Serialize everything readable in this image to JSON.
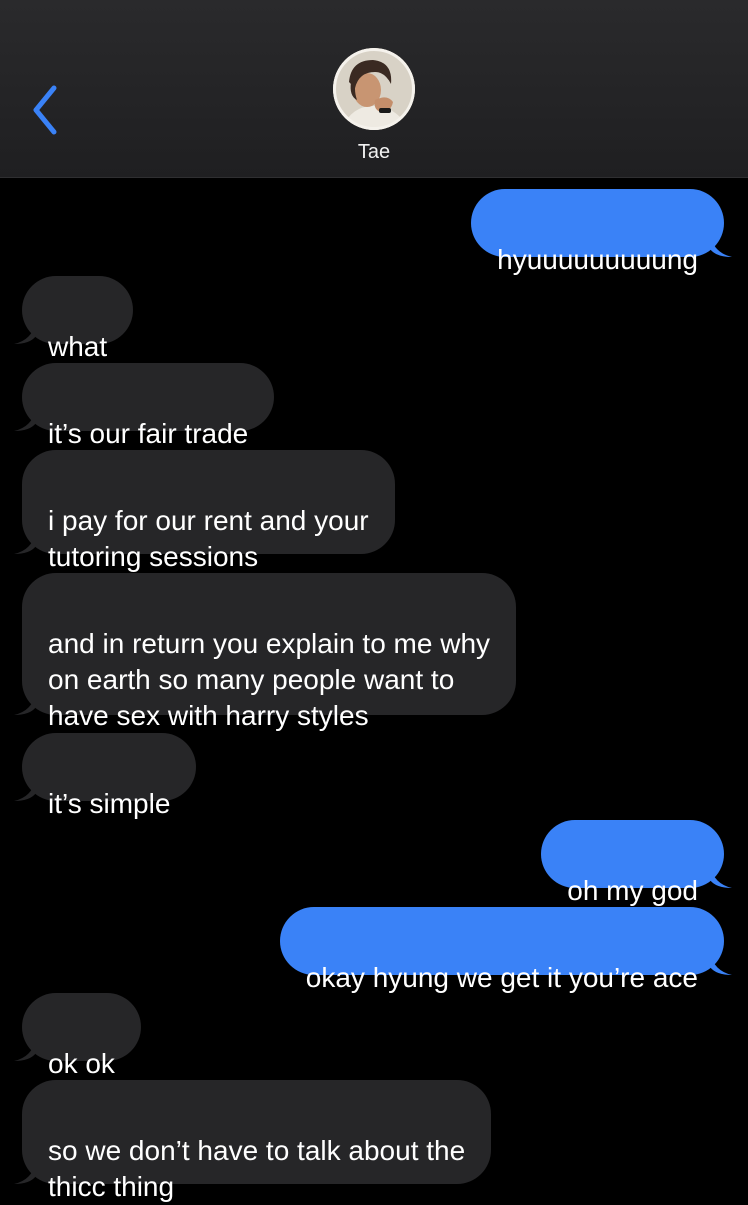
{
  "header": {
    "contact_name": "Tae"
  },
  "colors": {
    "incoming": "#262628",
    "outgoing": "#3a82f7",
    "back_icon": "#3a82f7"
  },
  "messages": [
    {
      "from": "me",
      "text": "hyuuuuuuuuung"
    },
    {
      "from": "them",
      "text": "what"
    },
    {
      "from": "them",
      "text": "it’s our fair trade"
    },
    {
      "from": "them",
      "text": "i pay for our rent and your\ntutoring sessions"
    },
    {
      "from": "them",
      "text": "and in return you explain to me why\non earth so many people want to\nhave sex with harry styles"
    },
    {
      "from": "them",
      "text": "it’s simple"
    },
    {
      "from": "me",
      "text": "oh my god"
    },
    {
      "from": "me",
      "text": "okay hyung we get it you’re ace"
    },
    {
      "from": "them",
      "text": "ok ok"
    },
    {
      "from": "them",
      "text": "so we don’t have to talk about the\nthicc thing"
    }
  ]
}
